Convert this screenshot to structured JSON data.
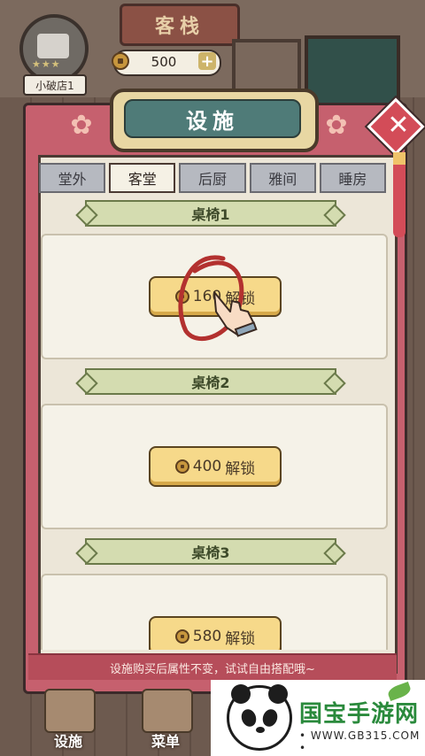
{
  "header": {
    "sign": "客栈",
    "shop_name": "小破店1",
    "stars": "★★★",
    "coins": "500",
    "add_coins_symbol": "+"
  },
  "panel": {
    "title": "设施",
    "close_symbol": "✕",
    "flower_symbol": "✿"
  },
  "tabs": [
    {
      "label": "堂外",
      "active": false
    },
    {
      "label": "客堂",
      "active": true
    },
    {
      "label": "后厨",
      "active": false
    },
    {
      "label": "雅间",
      "active": false
    },
    {
      "label": "睡房",
      "active": false
    }
  ],
  "sections": [
    {
      "title": "桌椅1",
      "button": {
        "cost": "160",
        "action": "解锁"
      }
    },
    {
      "title": "桌椅2",
      "button": {
        "cost": "400",
        "action": "解锁"
      }
    },
    {
      "title": "桌椅3",
      "button": {
        "cost": "580",
        "action": "解锁"
      }
    }
  ],
  "hint": "设施购买后属性不变，试试自由搭配哦~",
  "bottom_nav": [
    {
      "label": "设施"
    },
    {
      "label": "菜单"
    }
  ],
  "watermark": {
    "title": "国宝手游网",
    "url": "• WWW.GB315.COM •"
  },
  "colors": {
    "panel_red": "#c6606e",
    "title_teal": "#4f7b78",
    "button_gold": "#f6d98a",
    "ribbon_green": "#d4dcb0"
  }
}
